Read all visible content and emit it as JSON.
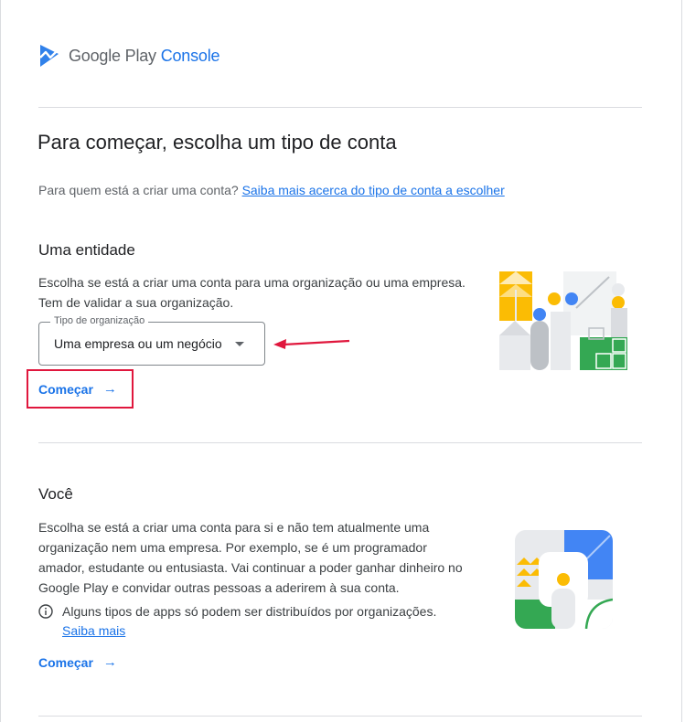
{
  "brand": {
    "google_play": "Google Play",
    "console": "Console"
  },
  "page": {
    "title": "Para começar, escolha um tipo de conta",
    "subtitle_text": "Para quem está a criar uma conta?",
    "subtitle_link": "Saiba mais acerca do tipo de conta a escolher"
  },
  "organization": {
    "heading": "Uma entidade",
    "description": [
      "Escolha se está a criar uma conta para uma organização ou uma empresa.",
      "Tem de validar a sua organização."
    ],
    "select_label": "Tipo de organização",
    "select_value": "Uma empresa ou um negócio",
    "start_label": "Começar"
  },
  "personal": {
    "heading": "Você",
    "description": [
      "Escolha se está a criar uma conta para si e não tem atualmente uma",
      "organização nem uma empresa. Por exemplo, se é um programador",
      "amador, estudante ou entusiasta. Vai continuar a poder ganhar dinheiro no",
      "Google Play e convidar outras pessoas a aderirem à sua conta."
    ],
    "info_text": "Alguns tipos de apps só podem ser distribuídos por organizações.",
    "info_link": "Saiba mais",
    "start_label": "Começar"
  },
  "colors": {
    "accent": "#1a73e8",
    "highlight": "#e0173d",
    "yellow": "#fbbc04",
    "green": "#34a853",
    "blue": "#4285f4"
  }
}
